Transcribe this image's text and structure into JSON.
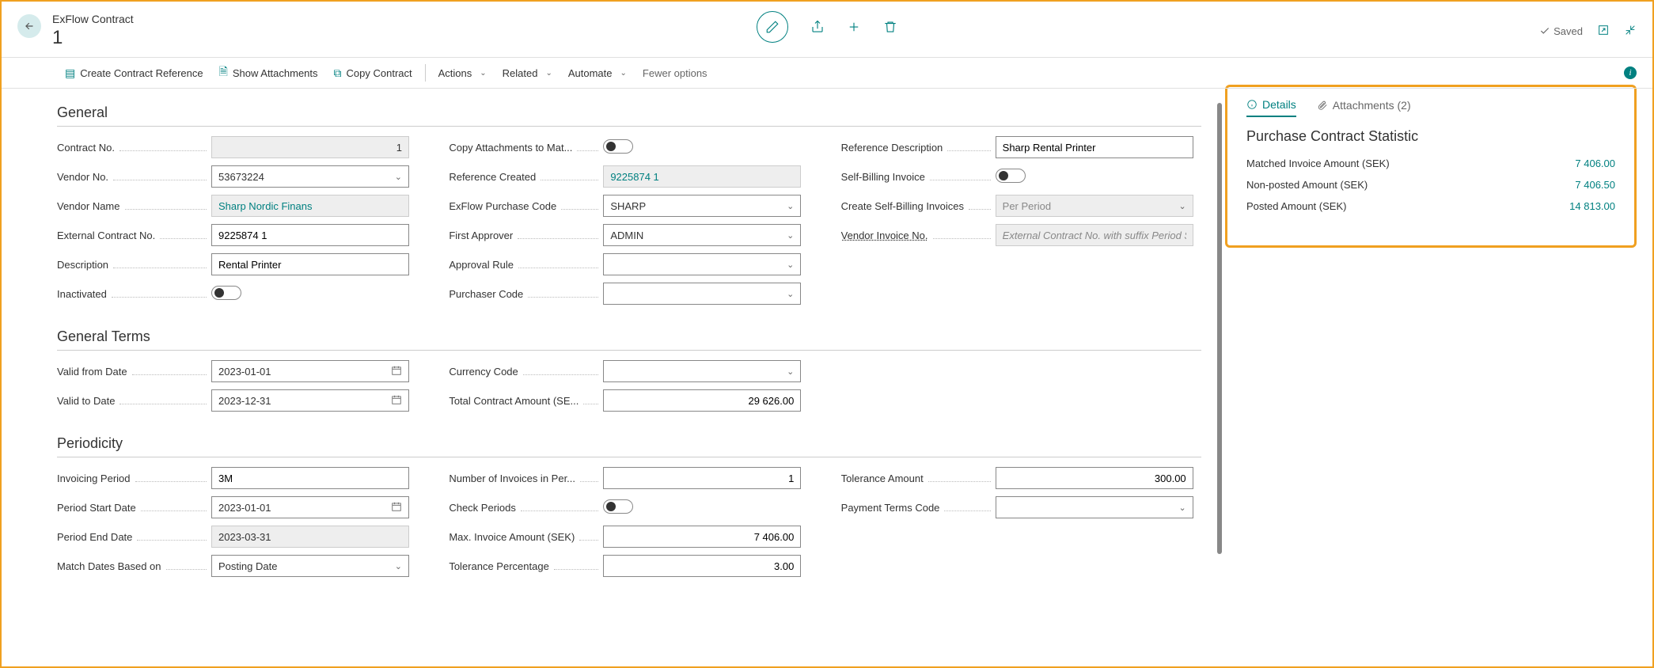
{
  "header": {
    "breadcrumb": "ExFlow Contract",
    "title": "1",
    "saved": "Saved"
  },
  "actions": {
    "create_ref": "Create Contract Reference",
    "show_attach": "Show Attachments",
    "copy_contract": "Copy Contract",
    "actions_menu": "Actions",
    "related_menu": "Related",
    "automate_menu": "Automate",
    "fewer": "Fewer options"
  },
  "sections": {
    "general": "General",
    "general_terms": "General Terms",
    "periodicity": "Periodicity"
  },
  "general": {
    "contract_no_label": "Contract No.",
    "contract_no": "1",
    "vendor_no_label": "Vendor No.",
    "vendor_no": "53673224",
    "vendor_name_label": "Vendor Name",
    "vendor_name": "Sharp Nordic Finans",
    "external_contract_no_label": "External Contract No.",
    "external_contract_no": "9225874 1",
    "description_label": "Description",
    "description": "Rental Printer",
    "inactivated_label": "Inactivated",
    "copy_attachments_label": "Copy Attachments to Mat...",
    "reference_created_label": "Reference Created",
    "reference_created": "9225874 1",
    "exflow_purchase_code_label": "ExFlow Purchase Code",
    "exflow_purchase_code": "SHARP",
    "first_approver_label": "First Approver",
    "first_approver": "ADMIN",
    "approval_rule_label": "Approval Rule",
    "approval_rule": "",
    "purchaser_code_label": "Purchaser Code",
    "purchaser_code": "",
    "reference_description_label": "Reference Description",
    "reference_description": "Sharp Rental Printer",
    "self_billing_label": "Self-Billing Invoice",
    "create_self_billing_label": "Create Self-Billing Invoices",
    "create_self_billing": "Per Period",
    "vendor_invoice_no_label": "Vendor Invoice No.",
    "vendor_invoice_no_placeholder": "External Contract No. with suffix Period S"
  },
  "terms": {
    "valid_from_label": "Valid from Date",
    "valid_from": "2023-01-01",
    "valid_to_label": "Valid to Date",
    "valid_to": "2023-12-31",
    "currency_code_label": "Currency Code",
    "currency_code": "",
    "total_contract_amount_label": "Total Contract Amount (SE...",
    "total_contract_amount": "29 626.00"
  },
  "periodicity": {
    "invoicing_period_label": "Invoicing Period",
    "invoicing_period": "3M",
    "period_start_label": "Period Start Date",
    "period_start": "2023-01-01",
    "period_end_label": "Period End Date",
    "period_end": "2023-03-31",
    "match_dates_label": "Match Dates Based on",
    "match_dates": "Posting Date",
    "num_invoices_label": "Number of Invoices in Per...",
    "num_invoices": "1",
    "check_periods_label": "Check Periods",
    "max_invoice_label": "Max. Invoice Amount (SEK)",
    "max_invoice": "7 406.00",
    "tolerance_pct_label": "Tolerance Percentage",
    "tolerance_pct": "3.00",
    "tolerance_amt_label": "Tolerance Amount",
    "tolerance_amt": "300.00",
    "payment_terms_label": "Payment Terms Code",
    "payment_terms": ""
  },
  "side": {
    "details_tab": "Details",
    "attachments_tab": "Attachments (2)",
    "title": "Purchase Contract Statistic",
    "matched_label": "Matched Invoice Amount (SEK)",
    "matched_value": "7 406.00",
    "nonposted_label": "Non-posted Amount (SEK)",
    "nonposted_value": "7 406.50",
    "posted_label": "Posted Amount (SEK)",
    "posted_value": "14 813.00"
  }
}
